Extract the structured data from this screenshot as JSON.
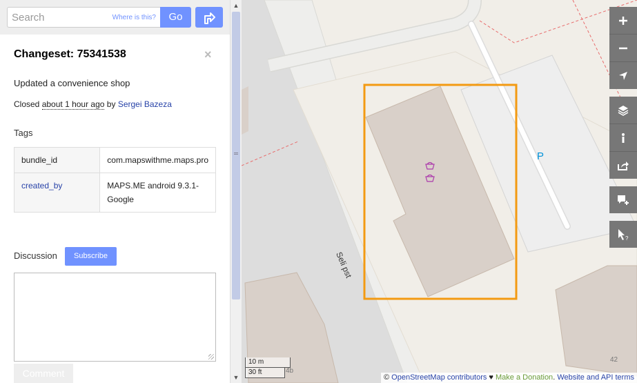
{
  "search": {
    "placeholder": "Search",
    "where_label": "Where is this?",
    "go_label": "Go"
  },
  "changeset": {
    "title": "Changeset: 75341538",
    "comment": "Updated a convenience shop",
    "closed_prefix": "Closed",
    "closed_ago": "about 1 hour ago",
    "closed_by": "by",
    "user": "Sergei Bazeza",
    "tags_heading": "Tags",
    "tags": [
      {
        "key": "bundle_id",
        "value": "com.mapswithme.maps.pro"
      },
      {
        "key": "created_by",
        "value": "MAPS.ME android 9.3.1-Google"
      }
    ],
    "discussion_heading": "Discussion",
    "subscribe_label": "Subscribe",
    "comment_button": "Comment"
  },
  "map": {
    "street_name": "Seli pst",
    "parking_label": "P",
    "house_number_1": "42",
    "house_number_2": "4b",
    "scale_metric": "10 m",
    "scale_imperial": "30 ft",
    "highlight_color": "#f39a12",
    "attribution": {
      "copyright": "©",
      "osm": "OpenStreetMap contributors",
      "heart": "♥",
      "donation": "Make a Donation",
      "terms": "Website and API terms"
    }
  },
  "controls": [
    "zoom-in-icon",
    "zoom-out-icon",
    "locate-icon",
    "layers-icon",
    "info-icon",
    "share-icon",
    "add-note-icon",
    "query-features-icon"
  ]
}
